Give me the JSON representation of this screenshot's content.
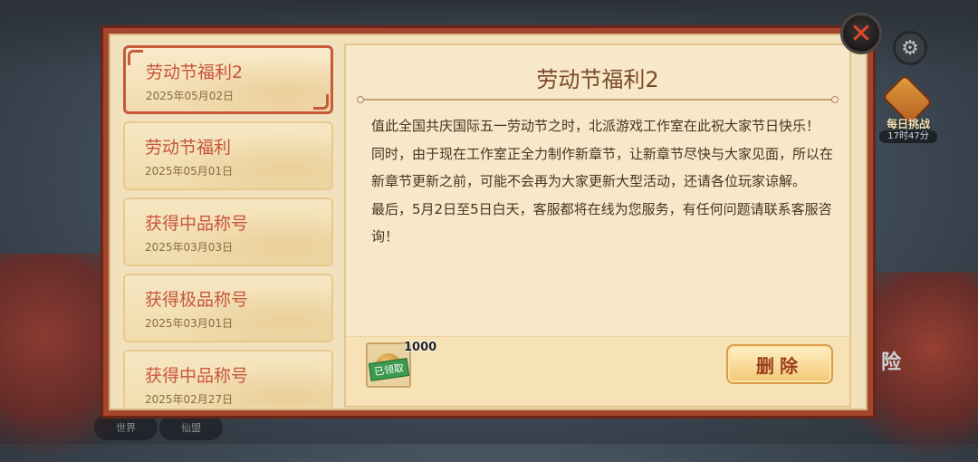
{
  "background": {
    "bottom_buttons": [
      "世界",
      "仙盟"
    ]
  },
  "side": {
    "daily_challenge": {
      "title": "每日挑战",
      "timer": "17时47分"
    },
    "adventure_label": "险",
    "settings_icon": "gear-icon"
  },
  "mail": {
    "items": [
      {
        "title": "劳动节福利2",
        "date": "2025年05月02日",
        "active": true
      },
      {
        "title": "劳动节福利",
        "date": "2025年05月01日",
        "active": false
      },
      {
        "title": "获得中品称号",
        "date": "2025年03月03日",
        "active": false
      },
      {
        "title": "获得极品称号",
        "date": "2025年03月01日",
        "active": false
      },
      {
        "title": "获得中品称号",
        "date": "2025年02月27日",
        "active": false
      }
    ],
    "detail": {
      "title": "劳动节福利2",
      "paragraphs": [
        "值此全国共庆国际五一劳动节之时，北派游戏工作室在此祝大家节日快乐！",
        "同时，由于现在工作室正全力制作新章节，让新章节尽快与大家见面，所以在新章节更新之前，可能不会再为大家更新大型活动，还请各位玩家谅解。",
        "最后，5月2日至5日白天，客服都将在线为您服务，有任何问题请联系客服咨询！"
      ],
      "reward": {
        "count": "1000",
        "status": "已领取",
        "icon": "currency-icon"
      },
      "delete_label": "删除"
    }
  },
  "colors": {
    "frame": "#a4452e",
    "accent_text": "#c8553a",
    "button_gold": "#f3c774"
  }
}
